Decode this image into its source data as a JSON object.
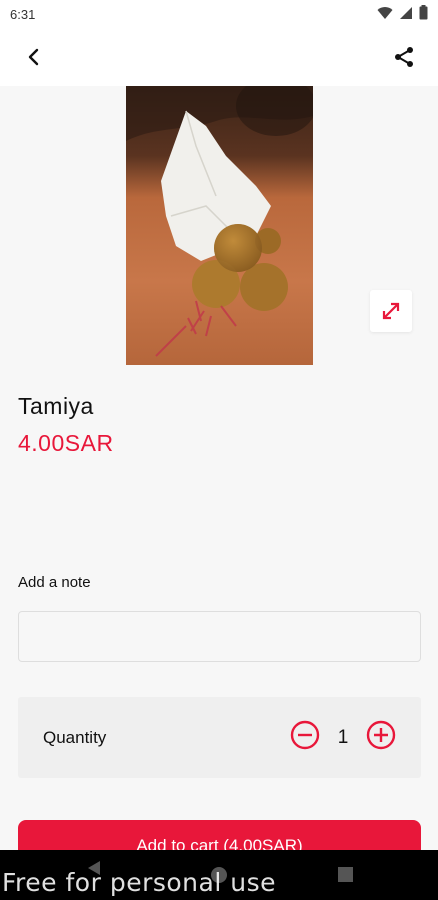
{
  "status_bar": {
    "time": "6:31"
  },
  "app_bar": {
    "back_icon": "back-arrow-icon",
    "share_icon": "share-icon"
  },
  "product": {
    "name": "Tamiya",
    "price": "4.00SAR"
  },
  "note": {
    "label": "Add a note",
    "value": "",
    "placeholder": ""
  },
  "quantity": {
    "label": "Quantity",
    "value": "1"
  },
  "cart": {
    "button_label": "Add to cart (4.00SAR)"
  },
  "watermark": "Free for personal use",
  "colors": {
    "accent": "#e8173a",
    "background": "#f7f7f7"
  }
}
